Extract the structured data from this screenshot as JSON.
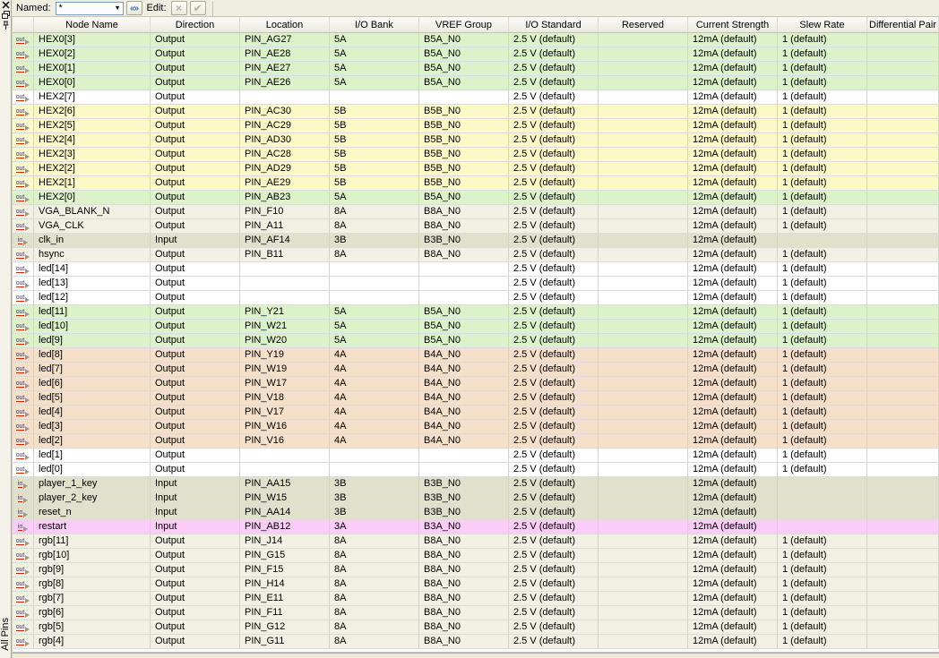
{
  "panel": {
    "title": "All Pins"
  },
  "dock": {
    "close_icon": "close-icon",
    "float_icon": "float-window-icon",
    "pin_icon": "auto-hide-pin-icon"
  },
  "toolbar": {
    "named_label": "Named:",
    "named_value": "*",
    "list_button_glyph": "«»",
    "edit_label": "Edit:",
    "cancel_glyph": "×",
    "accept_glyph": "✔"
  },
  "colors": {
    "green": "#dcf2c8",
    "yellow": "#fbf9c6",
    "white": "#ffffff",
    "beige": "#f1f0e2",
    "olive": "#e0e0cb",
    "orange": "#f5dfc8",
    "pink": "#fbccf7"
  },
  "table": {
    "headers": [
      "Node Name",
      "Direction",
      "Location",
      "I/O Bank",
      "VREF Group",
      "I/O Standard",
      "Reserved",
      "Current Strength",
      "Slew Rate",
      "Differential Pair"
    ]
  },
  "rows": [
    {
      "icon": "out",
      "name": "HEX0[3]",
      "direction": "Output",
      "location": "PIN_AG27",
      "bank": "5A",
      "vref": "B5A_N0",
      "standard": "2.5 V (default)",
      "reserved": "",
      "current": "12mA (default)",
      "slew": "1 (default)",
      "diff": "",
      "color": "green"
    },
    {
      "icon": "out",
      "name": "HEX0[2]",
      "direction": "Output",
      "location": "PIN_AE28",
      "bank": "5A",
      "vref": "B5A_N0",
      "standard": "2.5 V (default)",
      "reserved": "",
      "current": "12mA (default)",
      "slew": "1 (default)",
      "diff": "",
      "color": "green"
    },
    {
      "icon": "out",
      "name": "HEX0[1]",
      "direction": "Output",
      "location": "PIN_AE27",
      "bank": "5A",
      "vref": "B5A_N0",
      "standard": "2.5 V (default)",
      "reserved": "",
      "current": "12mA (default)",
      "slew": "1 (default)",
      "diff": "",
      "color": "green"
    },
    {
      "icon": "out",
      "name": "HEX0[0]",
      "direction": "Output",
      "location": "PIN_AE26",
      "bank": "5A",
      "vref": "B5A_N0",
      "standard": "2.5 V (default)",
      "reserved": "",
      "current": "12mA (default)",
      "slew": "1 (default)",
      "diff": "",
      "color": "green"
    },
    {
      "icon": "out",
      "name": "HEX2[7]",
      "direction": "Output",
      "location": "",
      "bank": "",
      "vref": "",
      "standard": "2.5 V (default)",
      "reserved": "",
      "current": "12mA (default)",
      "slew": "1 (default)",
      "diff": "",
      "color": "white"
    },
    {
      "icon": "out",
      "name": "HEX2[6]",
      "direction": "Output",
      "location": "PIN_AC30",
      "bank": "5B",
      "vref": "B5B_N0",
      "standard": "2.5 V (default)",
      "reserved": "",
      "current": "12mA (default)",
      "slew": "1 (default)",
      "diff": "",
      "color": "yellow"
    },
    {
      "icon": "out",
      "name": "HEX2[5]",
      "direction": "Output",
      "location": "PIN_AC29",
      "bank": "5B",
      "vref": "B5B_N0",
      "standard": "2.5 V (default)",
      "reserved": "",
      "current": "12mA (default)",
      "slew": "1 (default)",
      "diff": "",
      "color": "yellow"
    },
    {
      "icon": "out",
      "name": "HEX2[4]",
      "direction": "Output",
      "location": "PIN_AD30",
      "bank": "5B",
      "vref": "B5B_N0",
      "standard": "2.5 V (default)",
      "reserved": "",
      "current": "12mA (default)",
      "slew": "1 (default)",
      "diff": "",
      "color": "yellow"
    },
    {
      "icon": "out",
      "name": "HEX2[3]",
      "direction": "Output",
      "location": "PIN_AC28",
      "bank": "5B",
      "vref": "B5B_N0",
      "standard": "2.5 V (default)",
      "reserved": "",
      "current": "12mA (default)",
      "slew": "1 (default)",
      "diff": "",
      "color": "yellow"
    },
    {
      "icon": "out",
      "name": "HEX2[2]",
      "direction": "Output",
      "location": "PIN_AD29",
      "bank": "5B",
      "vref": "B5B_N0",
      "standard": "2.5 V (default)",
      "reserved": "",
      "current": "12mA (default)",
      "slew": "1 (default)",
      "diff": "",
      "color": "yellow"
    },
    {
      "icon": "out",
      "name": "HEX2[1]",
      "direction": "Output",
      "location": "PIN_AE29",
      "bank": "5B",
      "vref": "B5B_N0",
      "standard": "2.5 V (default)",
      "reserved": "",
      "current": "12mA (default)",
      "slew": "1 (default)",
      "diff": "",
      "color": "yellow"
    },
    {
      "icon": "out",
      "name": "HEX2[0]",
      "direction": "Output",
      "location": "PIN_AB23",
      "bank": "5A",
      "vref": "B5A_N0",
      "standard": "2.5 V (default)",
      "reserved": "",
      "current": "12mA (default)",
      "slew": "1 (default)",
      "diff": "",
      "color": "green"
    },
    {
      "icon": "out",
      "name": "VGA_BLANK_N",
      "direction": "Output",
      "location": "PIN_F10",
      "bank": "8A",
      "vref": "B8A_N0",
      "standard": "2.5 V (default)",
      "reserved": "",
      "current": "12mA (default)",
      "slew": "1 (default)",
      "diff": "",
      "color": "beige"
    },
    {
      "icon": "out",
      "name": "VGA_CLK",
      "direction": "Output",
      "location": "PIN_A11",
      "bank": "8A",
      "vref": "B8A_N0",
      "standard": "2.5 V (default)",
      "reserved": "",
      "current": "12mA (default)",
      "slew": "1 (default)",
      "diff": "",
      "color": "beige"
    },
    {
      "icon": "in",
      "name": "clk_in",
      "direction": "Input",
      "location": "PIN_AF14",
      "bank": "3B",
      "vref": "B3B_N0",
      "standard": "2.5 V (default)",
      "reserved": "",
      "current": "12mA (default)",
      "slew": "",
      "diff": "",
      "color": "olive"
    },
    {
      "icon": "out",
      "name": "hsync",
      "direction": "Output",
      "location": "PIN_B11",
      "bank": "8A",
      "vref": "B8A_N0",
      "standard": "2.5 V (default)",
      "reserved": "",
      "current": "12mA (default)",
      "slew": "1 (default)",
      "diff": "",
      "color": "beige"
    },
    {
      "icon": "out",
      "name": "led[14]",
      "direction": "Output",
      "location": "",
      "bank": "",
      "vref": "",
      "standard": "2.5 V (default)",
      "reserved": "",
      "current": "12mA (default)",
      "slew": "1 (default)",
      "diff": "",
      "color": "white"
    },
    {
      "icon": "out",
      "name": "led[13]",
      "direction": "Output",
      "location": "",
      "bank": "",
      "vref": "",
      "standard": "2.5 V (default)",
      "reserved": "",
      "current": "12mA (default)",
      "slew": "1 (default)",
      "diff": "",
      "color": "white"
    },
    {
      "icon": "out",
      "name": "led[12]",
      "direction": "Output",
      "location": "",
      "bank": "",
      "vref": "",
      "standard": "2.5 V (default)",
      "reserved": "",
      "current": "12mA (default)",
      "slew": "1 (default)",
      "diff": "",
      "color": "white"
    },
    {
      "icon": "out",
      "name": "led[11]",
      "direction": "Output",
      "location": "PIN_Y21",
      "bank": "5A",
      "vref": "B5A_N0",
      "standard": "2.5 V (default)",
      "reserved": "",
      "current": "12mA (default)",
      "slew": "1 (default)",
      "diff": "",
      "color": "green"
    },
    {
      "icon": "out",
      "name": "led[10]",
      "direction": "Output",
      "location": "PIN_W21",
      "bank": "5A",
      "vref": "B5A_N0",
      "standard": "2.5 V (default)",
      "reserved": "",
      "current": "12mA (default)",
      "slew": "1 (default)",
      "diff": "",
      "color": "green"
    },
    {
      "icon": "out",
      "name": "led[9]",
      "direction": "Output",
      "location": "PIN_W20",
      "bank": "5A",
      "vref": "B5A_N0",
      "standard": "2.5 V (default)",
      "reserved": "",
      "current": "12mA (default)",
      "slew": "1 (default)",
      "diff": "",
      "color": "green"
    },
    {
      "icon": "out",
      "name": "led[8]",
      "direction": "Output",
      "location": "PIN_Y19",
      "bank": "4A",
      "vref": "B4A_N0",
      "standard": "2.5 V (default)",
      "reserved": "",
      "current": "12mA (default)",
      "slew": "1 (default)",
      "diff": "",
      "color": "orange"
    },
    {
      "icon": "out",
      "name": "led[7]",
      "direction": "Output",
      "location": "PIN_W19",
      "bank": "4A",
      "vref": "B4A_N0",
      "standard": "2.5 V (default)",
      "reserved": "",
      "current": "12mA (default)",
      "slew": "1 (default)",
      "diff": "",
      "color": "orange"
    },
    {
      "icon": "out",
      "name": "led[6]",
      "direction": "Output",
      "location": "PIN_W17",
      "bank": "4A",
      "vref": "B4A_N0",
      "standard": "2.5 V (default)",
      "reserved": "",
      "current": "12mA (default)",
      "slew": "1 (default)",
      "diff": "",
      "color": "orange"
    },
    {
      "icon": "out",
      "name": "led[5]",
      "direction": "Output",
      "location": "PIN_V18",
      "bank": "4A",
      "vref": "B4A_N0",
      "standard": "2.5 V (default)",
      "reserved": "",
      "current": "12mA (default)",
      "slew": "1 (default)",
      "diff": "",
      "color": "orange"
    },
    {
      "icon": "out",
      "name": "led[4]",
      "direction": "Output",
      "location": "PIN_V17",
      "bank": "4A",
      "vref": "B4A_N0",
      "standard": "2.5 V (default)",
      "reserved": "",
      "current": "12mA (default)",
      "slew": "1 (default)",
      "diff": "",
      "color": "orange"
    },
    {
      "icon": "out",
      "name": "led[3]",
      "direction": "Output",
      "location": "PIN_W16",
      "bank": "4A",
      "vref": "B4A_N0",
      "standard": "2.5 V (default)",
      "reserved": "",
      "current": "12mA (default)",
      "slew": "1 (default)",
      "diff": "",
      "color": "orange"
    },
    {
      "icon": "out",
      "name": "led[2]",
      "direction": "Output",
      "location": "PIN_V16",
      "bank": "4A",
      "vref": "B4A_N0",
      "standard": "2.5 V (default)",
      "reserved": "",
      "current": "12mA (default)",
      "slew": "1 (default)",
      "diff": "",
      "color": "orange"
    },
    {
      "icon": "out",
      "name": "led[1]",
      "direction": "Output",
      "location": "",
      "bank": "",
      "vref": "",
      "standard": "2.5 V (default)",
      "reserved": "",
      "current": "12mA (default)",
      "slew": "1 (default)",
      "diff": "",
      "color": "white"
    },
    {
      "icon": "out",
      "name": "led[0]",
      "direction": "Output",
      "location": "",
      "bank": "",
      "vref": "",
      "standard": "2.5 V (default)",
      "reserved": "",
      "current": "12mA (default)",
      "slew": "1 (default)",
      "diff": "",
      "color": "white"
    },
    {
      "icon": "in",
      "name": "player_1_key",
      "direction": "Input",
      "location": "PIN_AA15",
      "bank": "3B",
      "vref": "B3B_N0",
      "standard": "2.5 V (default)",
      "reserved": "",
      "current": "12mA (default)",
      "slew": "",
      "diff": "",
      "color": "olive"
    },
    {
      "icon": "in",
      "name": "player_2_key",
      "direction": "Input",
      "location": "PIN_W15",
      "bank": "3B",
      "vref": "B3B_N0",
      "standard": "2.5 V (default)",
      "reserved": "",
      "current": "12mA (default)",
      "slew": "",
      "diff": "",
      "color": "olive"
    },
    {
      "icon": "in",
      "name": "reset_n",
      "direction": "Input",
      "location": "PIN_AA14",
      "bank": "3B",
      "vref": "B3B_N0",
      "standard": "2.5 V (default)",
      "reserved": "",
      "current": "12mA (default)",
      "slew": "",
      "diff": "",
      "color": "olive"
    },
    {
      "icon": "in",
      "name": "restart",
      "direction": "Input",
      "location": "PIN_AB12",
      "bank": "3A",
      "vref": "B3A_N0",
      "standard": "2.5 V (default)",
      "reserved": "",
      "current": "12mA (default)",
      "slew": "",
      "diff": "",
      "color": "pink"
    },
    {
      "icon": "out",
      "name": "rgb[11]",
      "direction": "Output",
      "location": "PIN_J14",
      "bank": "8A",
      "vref": "B8A_N0",
      "standard": "2.5 V (default)",
      "reserved": "",
      "current": "12mA (default)",
      "slew": "1 (default)",
      "diff": "",
      "color": "beige"
    },
    {
      "icon": "out",
      "name": "rgb[10]",
      "direction": "Output",
      "location": "PIN_G15",
      "bank": "8A",
      "vref": "B8A_N0",
      "standard": "2.5 V (default)",
      "reserved": "",
      "current": "12mA (default)",
      "slew": "1 (default)",
      "diff": "",
      "color": "beige"
    },
    {
      "icon": "out",
      "name": "rgb[9]",
      "direction": "Output",
      "location": "PIN_F15",
      "bank": "8A",
      "vref": "B8A_N0",
      "standard": "2.5 V (default)",
      "reserved": "",
      "current": "12mA (default)",
      "slew": "1 (default)",
      "diff": "",
      "color": "beige"
    },
    {
      "icon": "out",
      "name": "rgb[8]",
      "direction": "Output",
      "location": "PIN_H14",
      "bank": "8A",
      "vref": "B8A_N0",
      "standard": "2.5 V (default)",
      "reserved": "",
      "current": "12mA (default)",
      "slew": "1 (default)",
      "diff": "",
      "color": "beige"
    },
    {
      "icon": "out",
      "name": "rgb[7]",
      "direction": "Output",
      "location": "PIN_E11",
      "bank": "8A",
      "vref": "B8A_N0",
      "standard": "2.5 V (default)",
      "reserved": "",
      "current": "12mA (default)",
      "slew": "1 (default)",
      "diff": "",
      "color": "beige"
    },
    {
      "icon": "out",
      "name": "rgb[6]",
      "direction": "Output",
      "location": "PIN_F11",
      "bank": "8A",
      "vref": "B8A_N0",
      "standard": "2.5 V (default)",
      "reserved": "",
      "current": "12mA (default)",
      "slew": "1 (default)",
      "diff": "",
      "color": "beige"
    },
    {
      "icon": "out",
      "name": "rgb[5]",
      "direction": "Output",
      "location": "PIN_G12",
      "bank": "8A",
      "vref": "B8A_N0",
      "standard": "2.5 V (default)",
      "reserved": "",
      "current": "12mA (default)",
      "slew": "1 (default)",
      "diff": "",
      "color": "beige"
    },
    {
      "icon": "out",
      "name": "rgb[4]",
      "direction": "Output",
      "location": "PIN_G11",
      "bank": "8A",
      "vref": "B8A_N0",
      "standard": "2.5 V (default)",
      "reserved": "",
      "current": "12mA (default)",
      "slew": "1 (default)",
      "diff": "",
      "color": "beige"
    }
  ]
}
